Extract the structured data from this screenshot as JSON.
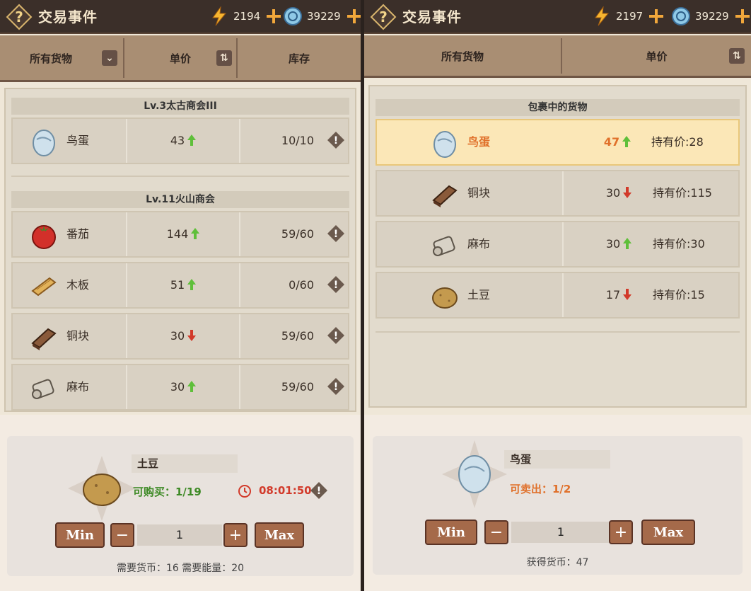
{
  "left": {
    "title": "交易事件",
    "energy": "2194",
    "currency": "39229",
    "header": {
      "col1": "所有货物",
      "col2": "单价",
      "col3": "库存"
    },
    "groups": [
      {
        "name": "Lv.3太古商会III",
        "items": [
          {
            "name": "鸟蛋",
            "price": "43",
            "trend": "up",
            "stock": "10/10",
            "icon": "egg-icon"
          }
        ]
      },
      {
        "name": "Lv.11火山商会",
        "items": [
          {
            "name": "番茄",
            "price": "144",
            "trend": "up",
            "stock": "59/60",
            "icon": "tomato-icon"
          },
          {
            "name": "木板",
            "price": "51",
            "trend": "up",
            "stock": "0/60",
            "icon": "wood-plank-icon"
          },
          {
            "name": "铜块",
            "price": "30",
            "trend": "down",
            "stock": "59/60",
            "icon": "copper-block-icon"
          },
          {
            "name": "麻布",
            "price": "30",
            "trend": "up",
            "stock": "59/60",
            "icon": "linen-icon"
          }
        ]
      }
    ],
    "selected": {
      "name": "土豆",
      "buyable": "可购买：1/19",
      "timer": "08:01:50",
      "quantity": "1",
      "cost": "需要货币：16 需要能量：20"
    },
    "buttons": {
      "min": "Min",
      "max": "Max",
      "minus": "−",
      "plus": "+"
    }
  },
  "right": {
    "title": "交易事件",
    "energy": "2197",
    "currency": "39229",
    "header": {
      "col1": "所有货物",
      "col2": "单价"
    },
    "group": "包裹中的货物",
    "items": [
      {
        "name": "鸟蛋",
        "price": "47",
        "trend": "up",
        "hold": "持有价:28",
        "icon": "egg-icon",
        "selected": true
      },
      {
        "name": "铜块",
        "price": "30",
        "trend": "down",
        "hold": "持有价:115",
        "icon": "copper-block-icon"
      },
      {
        "name": "麻布",
        "price": "30",
        "trend": "up",
        "hold": "持有价:30",
        "icon": "linen-icon"
      },
      {
        "name": "土豆",
        "price": "17",
        "trend": "down",
        "hold": "持有价:15",
        "icon": "potato-icon"
      }
    ],
    "selected": {
      "name": "鸟蛋",
      "sellable": "可卖出：1/2",
      "quantity": "1",
      "earn": "获得货币：47"
    },
    "buttons": {
      "min": "Min",
      "max": "Max",
      "minus": "−",
      "plus": "+"
    }
  },
  "colors": {
    "up": "#5fbf3a",
    "down": "#d23a2a",
    "accent": "#f1a73b",
    "selectedRow": "#fbe7b7"
  }
}
